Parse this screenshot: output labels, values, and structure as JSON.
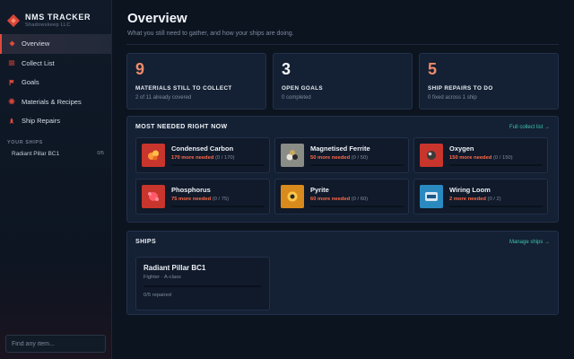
{
  "brand": {
    "title": "NMS TRACKER",
    "subtitle": "Shadowskeep LLC"
  },
  "nav": [
    {
      "label": "Overview",
      "icon": "diamond-icon",
      "active": true
    },
    {
      "label": "Collect List",
      "icon": "list-icon",
      "active": false
    },
    {
      "label": "Goals",
      "icon": "flag-icon",
      "active": false
    },
    {
      "label": "Materials & Recipes",
      "icon": "atom-icon",
      "active": false
    },
    {
      "label": "Ship Repairs",
      "icon": "rocket-icon",
      "active": false
    }
  ],
  "sidebar_ships": {
    "label": "YOUR SHIPS",
    "items": [
      {
        "name": "Radiant Pillar BC1",
        "count": "0/5"
      }
    ]
  },
  "search": {
    "placeholder": "Find any item..."
  },
  "page": {
    "title": "Overview",
    "subtitle": "What you still need to gather, and how your ships are doing."
  },
  "stats": [
    {
      "value": "9",
      "label": "MATERIALS STILL TO COLLECT",
      "sub": "2 of 11 already covered",
      "color": "#f08a6a"
    },
    {
      "value": "3",
      "label": "OPEN GOALS",
      "sub": "0 completed",
      "color": "#f3f6fb"
    },
    {
      "value": "5",
      "label": "SHIP REPAIRS TO DO",
      "sub": "0 fixed across 1 ship",
      "color": "#f08a6a"
    }
  ],
  "needed": {
    "title": "MOST NEEDED RIGHT NOW",
    "link": "Full collect list →",
    "items": [
      {
        "name": "Condensed Carbon",
        "more": "170 more needed",
        "detail": " (0 / 170)",
        "progress": 0,
        "icon": "carbon-icon",
        "bg": "#c8352c"
      },
      {
        "name": "Magnetised Ferrite",
        "more": "50 more needed",
        "detail": " (0 / 50)",
        "progress": 0,
        "icon": "ferrite-icon",
        "bg": "#8a8c86"
      },
      {
        "name": "Oxygen",
        "more": "150 more needed",
        "detail": " (0 / 150)",
        "progress": 0,
        "icon": "oxygen-icon",
        "bg": "#c8352c"
      },
      {
        "name": "Phosphorus",
        "more": "75 more needed",
        "detail": " (0 / 75)",
        "progress": 0,
        "icon": "phosphorus-icon",
        "bg": "#c8352c"
      },
      {
        "name": "Pyrite",
        "more": "60 more needed",
        "detail": " (0 / 60)",
        "progress": 0,
        "icon": "pyrite-icon",
        "bg": "#d98a1c"
      },
      {
        "name": "Wiring Loom",
        "more": "2 more needed",
        "detail": " (0 / 2)",
        "progress": 0,
        "icon": "wiring-loom-icon",
        "bg": "#2a8ac0"
      }
    ]
  },
  "ships": {
    "title": "SHIPS",
    "link": "Manage ships →",
    "items": [
      {
        "name": "Radiant Pillar BC1",
        "class": "Fighter · A-class",
        "repaired": "0/5 repaired",
        "progress": 0
      }
    ]
  },
  "colors": {
    "accent": "#e04a3c",
    "teal": "#3ec4b0",
    "highlight": "#ff6a4a",
    "panel": "#142033"
  }
}
